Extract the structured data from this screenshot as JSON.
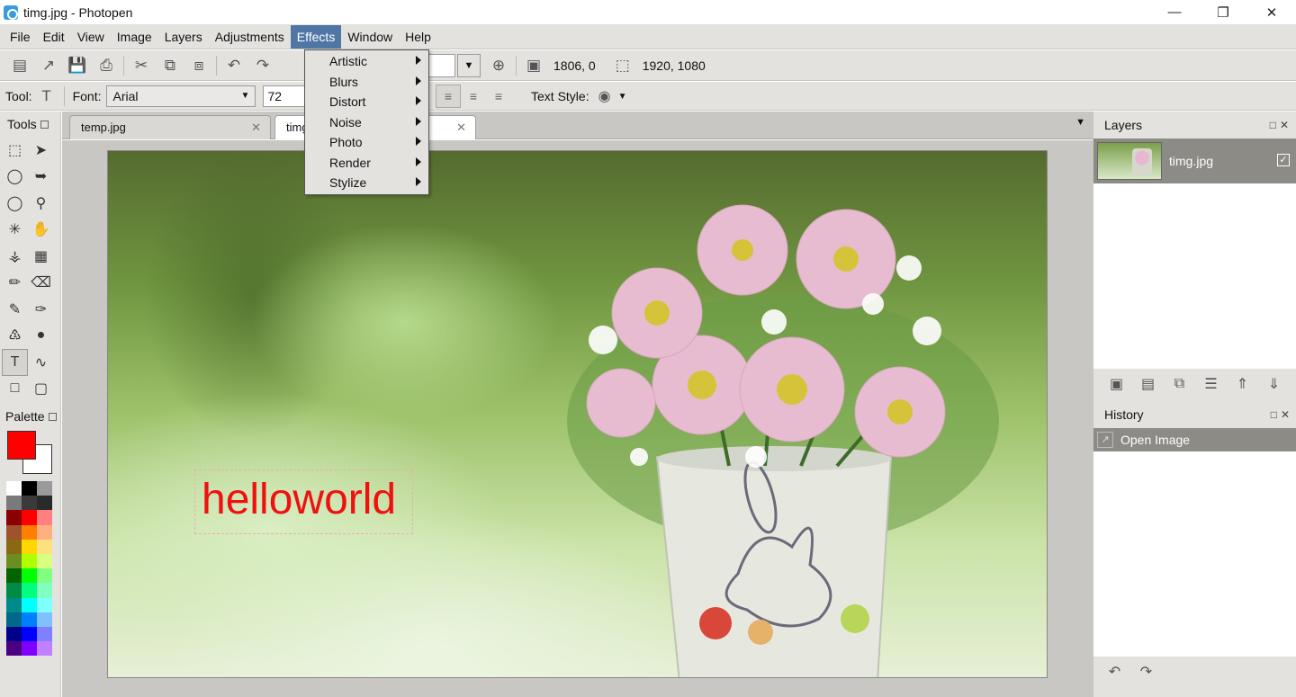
{
  "window": {
    "title": "timg.jpg - Photopen",
    "controls": [
      "minimize",
      "maximize",
      "close"
    ]
  },
  "menubar": {
    "items": [
      "File",
      "Edit",
      "View",
      "Image",
      "Layers",
      "Adjustments",
      "Effects",
      "Window",
      "Help"
    ],
    "active": "Effects"
  },
  "effects_menu": {
    "items": [
      "Artistic",
      "Blurs",
      "Distort",
      "Noise",
      "Photo",
      "Render",
      "Stylize"
    ]
  },
  "toolbar": {
    "cursor_position": "1806, 0",
    "selection_size": "1920, 1080"
  },
  "text_toolbar": {
    "tool_label": "Tool:",
    "font_label": "Font:",
    "font_value": "Arial",
    "size_value": "72",
    "text_style_label": "Text Style:"
  },
  "tools_panel": {
    "title": "Tools"
  },
  "palette_panel": {
    "title": "Palette",
    "primary_color": "#ff0000",
    "secondary_color": "#ffffff",
    "swatches": [
      "#ffffff",
      "#000000",
      "#9a9a9a",
      "#7a7a7a",
      "#3a3a3a",
      "#2a2a2a",
      "#8b0000",
      "#ff0000",
      "#ff8080",
      "#a0522d",
      "#ff7f00",
      "#ffb080",
      "#8b6914",
      "#ffd700",
      "#ffe080",
      "#6b8e23",
      "#b0ff00",
      "#d8ff80",
      "#006400",
      "#00ff00",
      "#80ff80",
      "#008b45",
      "#00ff7f",
      "#80ffc0",
      "#008b8b",
      "#00ffff",
      "#80ffff",
      "#00688b",
      "#0080ff",
      "#80c0ff",
      "#00008b",
      "#0000ff",
      "#8080ff",
      "#4b0082",
      "#8000ff",
      "#c080ff"
    ]
  },
  "tabs": [
    {
      "label": "temp.jpg"
    },
    {
      "label": "timg"
    }
  ],
  "canvas": {
    "text_layer": "helloworld"
  },
  "layers_panel": {
    "title": "Layers",
    "layers": [
      {
        "name": "timg.jpg",
        "visible": true
      }
    ]
  },
  "history_panel": {
    "title": "History",
    "entries": [
      "Open Image"
    ]
  }
}
